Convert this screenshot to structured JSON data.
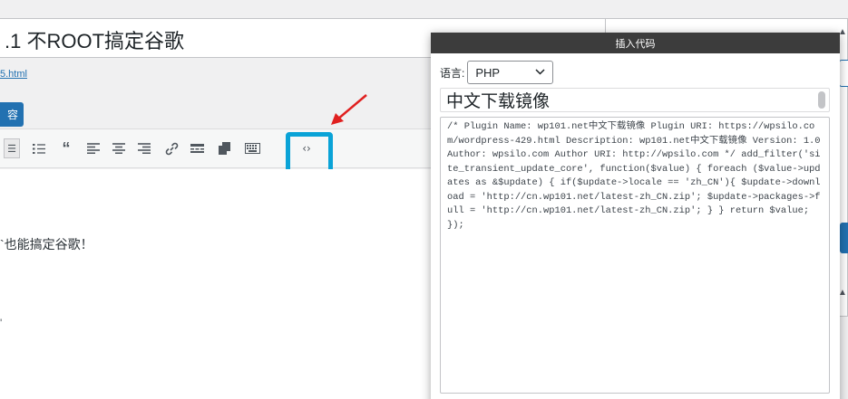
{
  "editor": {
    "post_title": ".1 不ROOT搞定谷歌",
    "permalink": "5.html",
    "add_media_label": "容",
    "content_line": "`也能搞定谷歌！",
    "content_small": "'"
  },
  "toolbar": {
    "buttons": [
      {
        "name": "bulleted-list-icon",
        "glyph": "☰"
      },
      {
        "name": "numbered-list-icon",
        "glyph": "☷"
      },
      {
        "name": "blockquote-icon",
        "glyph": "❝"
      },
      {
        "name": "align-left-icon",
        "glyph": "≡"
      },
      {
        "name": "align-center-icon",
        "glyph": "≡"
      },
      {
        "name": "align-right-icon",
        "glyph": "≡"
      },
      {
        "name": "link-icon",
        "glyph": "🔗"
      },
      {
        "name": "read-more-icon",
        "glyph": "▬"
      },
      {
        "name": "toolbar-toggle-icon",
        "glyph": "▇"
      },
      {
        "name": "keyboard-icon",
        "glyph": "⌨"
      },
      {
        "name": "insert-code-icon",
        "glyph": "<>"
      }
    ]
  },
  "dialog": {
    "title": "插入代码",
    "language_label": "语言:",
    "language_value": "PHP",
    "snippet_title": "中文下载镜像",
    "code": "/* Plugin Name: wp101.net中文下载镜像 Plugin URI: https://wpsilo.com/wordpress-429.html Description: wp101.net中文下载镜像 Version: 1.0 Author: wpsilo.com Author URI: http://wpsilo.com */ add_filter('site_transient_update_core', function($value) { foreach ($value->updates as &$update) { if($update->locale == 'zh_CN'){ $update->download = 'http://cn.wp101.net/latest-zh_CN.zip'; $update->packages->full = 'http://cn.wp101.net/latest-zh_CN.zip'; } } return $value; });"
  },
  "colors": {
    "highlight": "#0aa3d7",
    "arrow": "#e02020",
    "wp_blue": "#2271b1",
    "dialog_header": "#3c3c3c"
  }
}
